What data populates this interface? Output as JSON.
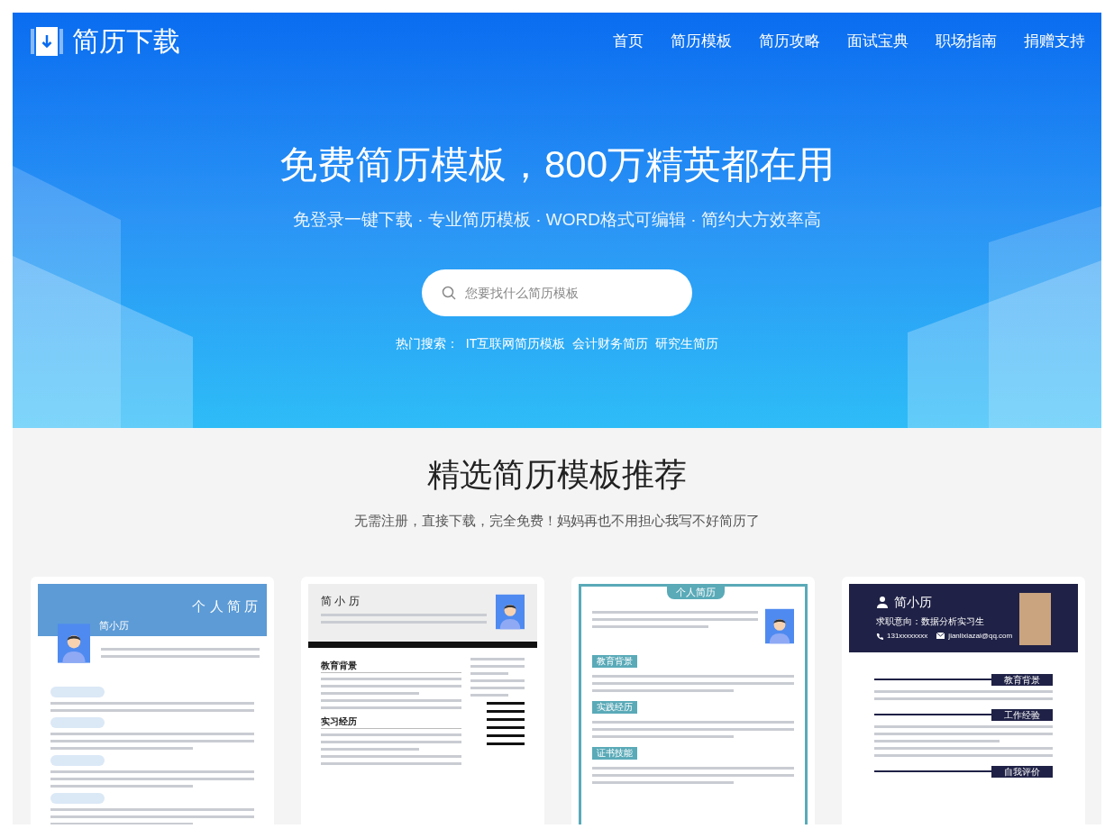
{
  "header": {
    "logo_text": "简历下载",
    "nav": [
      {
        "label": "首页"
      },
      {
        "label": "简历模板"
      },
      {
        "label": "简历攻略"
      },
      {
        "label": "面试宝典"
      },
      {
        "label": "职场指南"
      },
      {
        "label": "捐赠支持"
      }
    ]
  },
  "hero": {
    "title": "免费简历模板，800万精英都在用",
    "subtitle": "免登录一键下载 · 专业简历模板 · WORD格式可编辑 · 简约大方效率高",
    "search": {
      "placeholder": "您要找什么简历模板"
    },
    "hot_label": "热门搜索：",
    "hot_links": [
      "IT互联网简历模板",
      "会计财务简历",
      "研究生简历"
    ]
  },
  "section": {
    "title": "精选简历模板推荐",
    "subtitle": "无需注册，直接下载，完全免费！妈妈再也不用担心我写不好简历了"
  },
  "templates": [
    {
      "kind": "blue-banner",
      "title": "个 人 简 历",
      "name": "简小历"
    },
    {
      "kind": "gray-header",
      "name": "简 小 历",
      "sections": [
        "教育背景",
        "实习经历"
      ]
    },
    {
      "kind": "teal-frame",
      "title": "个人简历",
      "sections": [
        "教育背景",
        "实践经历",
        "证书技能"
      ]
    },
    {
      "kind": "navy-header",
      "name": "简小历",
      "intent": "求职意向：数据分析实习生",
      "phone": "131xxxxxxxx",
      "email": "jianlixiazai@qq.com",
      "sections": [
        "教育背景",
        "工作经验",
        "自我评价"
      ]
    }
  ]
}
